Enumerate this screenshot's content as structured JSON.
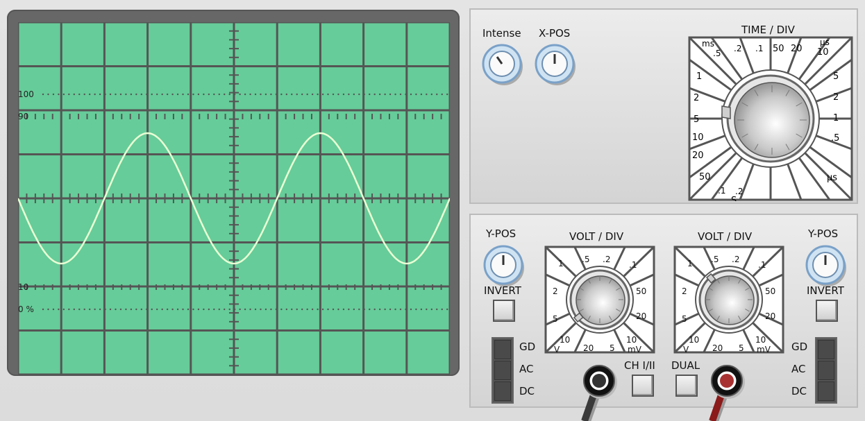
{
  "screen": {
    "bg": "#66cc99",
    "grid_color": "#555555",
    "trace_color": "#eaffd5",
    "markers": {
      "m100": "100",
      "m90": "90",
      "m10": "10",
      "m0": "0 %"
    },
    "trace": {
      "cycles": 2.5,
      "phase": "starts at center line going down"
    }
  },
  "controls_top": {
    "intensity_label": "Intense",
    "xpos_label": "X-POS",
    "time_div_label": "TIME / DIV",
    "time_ticks": {
      "ms": "ms",
      "p5": ".5",
      "p2": ".2",
      "p1": ".1",
      "t50": "50",
      "t20": "20",
      "us_top": "µs",
      "t10": "10",
      "l1": "1",
      "l2": "2",
      "l5": "5",
      "l10": "10",
      "l20": "20",
      "l50": "50",
      "b1": ".1",
      "b2": ".2",
      "s": "S",
      "r5": "5",
      "r2": "2",
      "r1": "1",
      "rp5": ".5",
      "us_bottom": "µs"
    }
  },
  "controls_bottom": {
    "ch1": {
      "ypos_label": "Y-POS",
      "invert_label": "INVERT",
      "volt_div_label": "VOLT / DIV",
      "gd": "GD",
      "ac": "AC",
      "dc": "DC"
    },
    "ch2": {
      "ypos_label": "Y-POS",
      "invert_label": "INVERT",
      "volt_div_label": "VOLT / DIV",
      "gd": "GD",
      "ac": "AC",
      "dc": "DC"
    },
    "volt_ticks": {
      "v1": "1",
      "vp5": ".5",
      "vp2": ".2",
      "vp1": ".1",
      "v2": "2",
      "v50": "50",
      "v5": "5",
      "v20": "20",
      "v10": "10",
      "vV": "V",
      "b20": "20",
      "b5": "5",
      "b10": "10",
      "mV": "mV"
    },
    "ch_toggle_label": "CH I/II",
    "dual_label": "DUAL"
  }
}
